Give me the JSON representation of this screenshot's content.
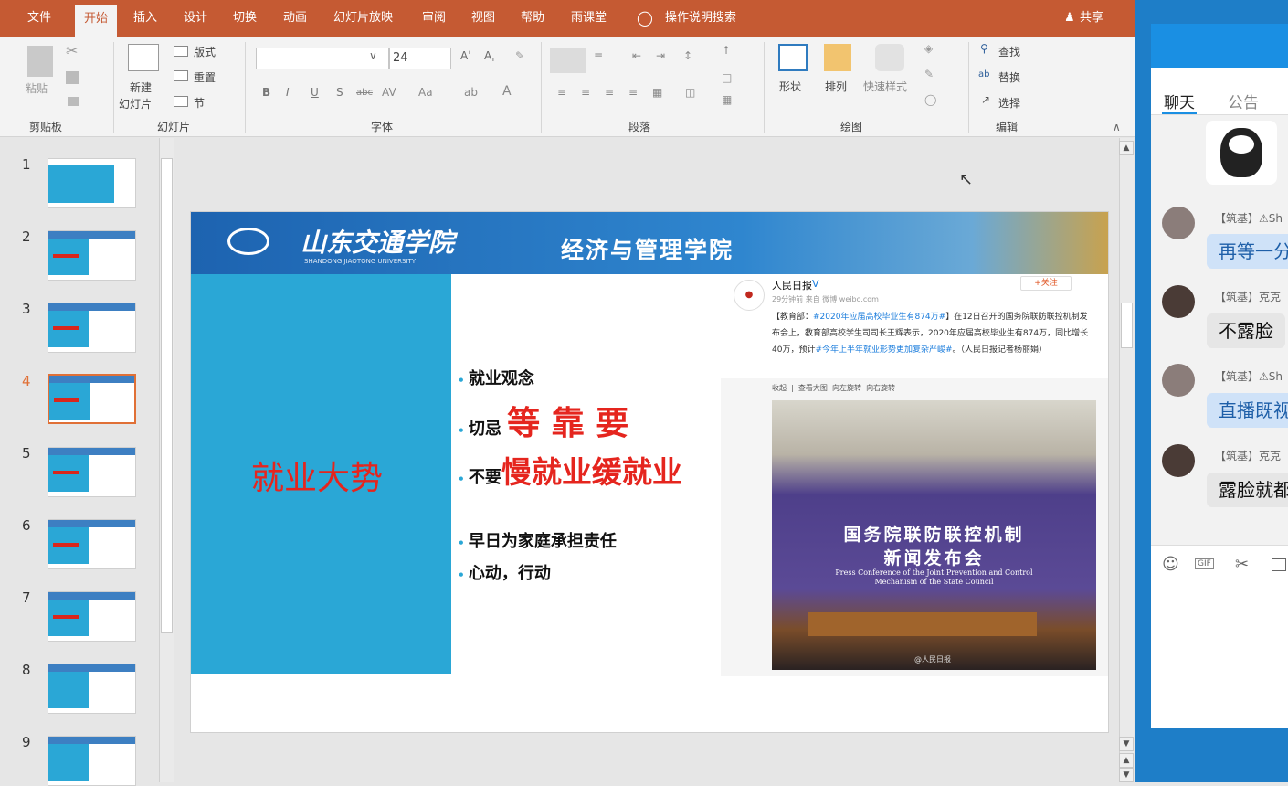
{
  "tabs": [
    "文件",
    "开始",
    "插入",
    "设计",
    "切换",
    "动画",
    "幻灯片放映",
    "审阅",
    "视图",
    "帮助",
    "雨课堂"
  ],
  "search_label": "操作说明搜索",
  "share_label": "共享",
  "ribbon": {
    "paste": "粘贴",
    "new_slide_1": "新建",
    "new_slide_2": "幻灯片",
    "layout": "版式",
    "reset": "重置",
    "section": "节",
    "font_size": "24",
    "shape": "形状",
    "arrange": "排列",
    "quick_style": "快速样式",
    "find": "查找",
    "replace": "替换",
    "select": "选择",
    "groups": [
      "剪贴板",
      "幻灯片",
      "字体",
      "段落",
      "绘图",
      "编辑"
    ]
  },
  "thumbs": [
    "1",
    "2",
    "3",
    "4",
    "5",
    "6",
    "7",
    "8",
    "9"
  ],
  "slide": {
    "banner_school": "山东交通学院",
    "banner_school_en": "SHANDONG JIAOTONG UNIVERSITY",
    "banner_college": "经济与管理学院",
    "big_title": "就业大势",
    "b1": "就业观念",
    "b2_pre": "切忌",
    "b2_big": "等 靠 要",
    "b3_pre": "不要",
    "b3_big": "慢就业缓就业",
    "b4": "早日为家庭承担责任",
    "b5": "心动，行动",
    "weibo": {
      "name": "人民日报",
      "follow": "+关注",
      "meta": "29分钟前 来自 微博 weibo.com",
      "body_1": "【教育部：",
      "tag_1": "#2020年应届高校毕业生有874万#",
      "body_2": "】在12日召开的国务院联防联控机制发布会上，教育部高校学生司司长王辉表示，2020年应届高校毕业生有874万，同比增长40万，预计",
      "tag_2": "#今年上半年就业形势更加复杂严峻#",
      "body_3": "。（人民日报记者杨丽娟）",
      "actions": [
        "收起",
        "查看大图",
        "向左旋转",
        "向右旋转"
      ],
      "photo_title_1": "国务院联防联控机制",
      "photo_title_2": "新闻发布会",
      "photo_en_1": "Press Conference of the Joint Prevention and Control",
      "photo_en_2": "Mechanism of the State Council",
      "photo_mark": "@人民日报"
    }
  },
  "chat": {
    "tab_chat": "聊天",
    "tab_notice": "公告",
    "messages": [
      {
        "sender": "【筑基】⚠Sh",
        "text": "再等一分",
        "style": "blue"
      },
      {
        "sender": "【筑基】克克",
        "text": "不露脸",
        "style": "gray"
      },
      {
        "sender": "【筑基】⚠Sh",
        "text": "直播既视",
        "style": "blue"
      },
      {
        "sender": "【筑基】克克",
        "text": "露脸就都",
        "style": "gray"
      }
    ]
  }
}
